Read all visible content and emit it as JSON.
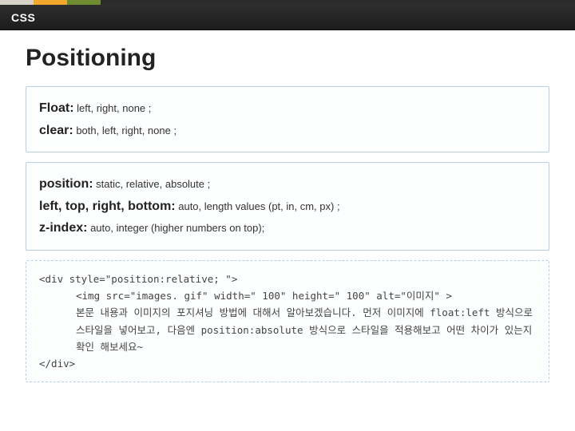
{
  "header": {
    "label": "CSS"
  },
  "title": "Positioning",
  "box1": {
    "float_prop": "Float:",
    "float_vals": " left, right, none ;",
    "clear_prop": "clear:",
    "clear_vals": " both, left, right, none ;"
  },
  "box2": {
    "position_prop": "position:",
    "position_vals": " static, relative, absolute ;",
    "ltrb_prop": "left, top, right, bottom:",
    "ltrb_vals": " auto, length values (pt, in, cm, px) ;",
    "zindex_prop": "z-index:",
    "zindex_vals": " auto, integer (higher numbers on top);"
  },
  "box3": {
    "l1": "<div  style=\"position:relative; \">",
    "l2": "<img src=\"images. gif\" width=\" 100\" height=\" 100\" alt=\"이미지\" >",
    "l3": "본문 내용과 이미지의 포지셔닝 방법에 대해서 알아보겠습니다. 먼저 이미지에 float:left 방식으로 스타일을 넣어보고, 다음엔 position:absolute 방식으로 스타일을 적용해보고 어떤 차이가 있는지 확인 해보세요~",
    "l4": "</div>"
  }
}
